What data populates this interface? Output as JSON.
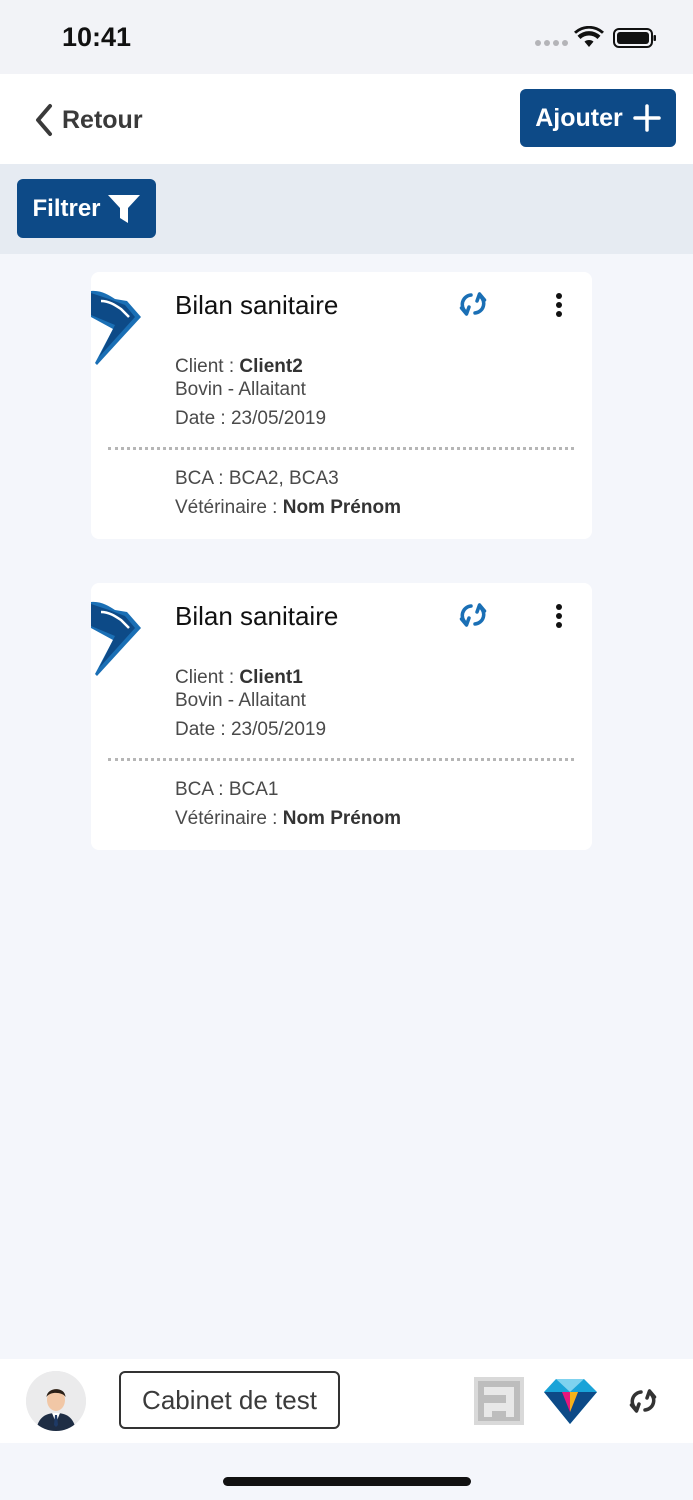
{
  "status_bar": {
    "time": "10:41"
  },
  "nav": {
    "back_label": "Retour",
    "add_label": "Ajouter"
  },
  "filter": {
    "label": "Filtrer"
  },
  "cards": [
    {
      "title": "Bilan sanitaire",
      "client_label": "Client : ",
      "client_value": "Client2",
      "species": "Bovin - Allaitant",
      "date": "Date : 23/05/2019",
      "bca": "BCA : BCA2, BCA3",
      "vet_label": "Vétérinaire : ",
      "vet_value": "Nom Prénom"
    },
    {
      "title": "Bilan sanitaire",
      "client_label": "Client : ",
      "client_value": "Client1",
      "species": "Bovin - Allaitant",
      "date": "Date : 23/05/2019",
      "bca": "BCA : BCA1",
      "vet_label": "Vétérinaire : ",
      "vet_value": "Nom Prénom"
    }
  ],
  "bottom_bar": {
    "cabinet_label": "Cabinet de test"
  },
  "colors": {
    "primary": "#0d4a87",
    "accent_blue": "#1a6fb5",
    "background": "#f4f6fb",
    "filter_bar": "#e6ebf2"
  },
  "icons": {
    "back": "chevron-left-icon",
    "add": "plus-icon",
    "filter": "funnel-icon",
    "sync": "sync-icon",
    "menu": "vertical-dots-icon"
  }
}
